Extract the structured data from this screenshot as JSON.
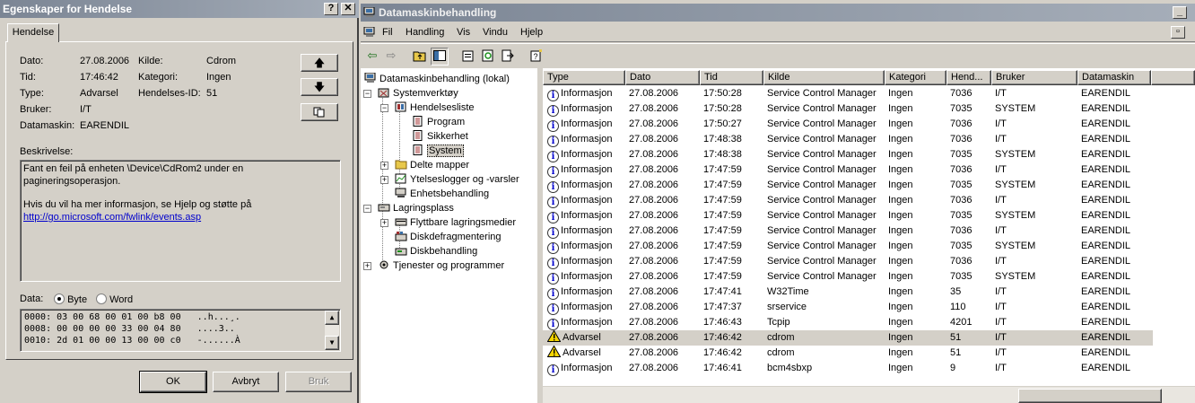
{
  "dialog": {
    "title": "Egenskaper for Hendelse",
    "tab": "Hendelse",
    "fields": {
      "dato_label": "Dato:",
      "dato": "27.08.2006",
      "tid_label": "Tid:",
      "tid": "17:46:42",
      "type_label": "Type:",
      "type": "Advarsel",
      "bruker_label": "Bruker:",
      "bruker": "I/T",
      "datamaskin_label": "Datamaskin:",
      "datamaskin": "EARENDIL",
      "kilde_label": "Kilde:",
      "kilde": "Cdrom",
      "kategori_label": "Kategori:",
      "kategori": "Ingen",
      "hendelses_id_label": "Hendelses-ID:",
      "hendelses_id": "51"
    },
    "description_label": "Beskrivelse:",
    "description_line1": "Fant en feil på enheten \\Device\\CdRom2 under en pagineringsoperasjon.",
    "description_line2": "Hvis du vil ha mer informasjon, se Hjelp og støtte på",
    "description_link": "http://go.microsoft.com/fwlink/events.asp",
    "data_label": "Data:",
    "radio_byte": "Byte",
    "radio_word": "Word",
    "hex_lines": [
      "0000: 03 00 68 00 01 00 b8 00   ..h...¸.",
      "0008: 00 00 00 00 33 00 04 80   ....3..",
      "0010: 2d 01 00 00 13 00 00 c0   -......À"
    ],
    "buttons": {
      "ok": "OK",
      "cancel": "Avbryt",
      "apply": "Bruk"
    }
  },
  "window": {
    "title": "Datamaskinbehandling",
    "menu": [
      "Fil",
      "Handling",
      "Vis",
      "Vindu",
      "Hjelp"
    ],
    "tree": [
      {
        "label": "Datamaskinbehandling (lokal)"
      },
      {
        "label": "Systemverktøy"
      },
      {
        "label": "Hendelsesliste"
      },
      {
        "label": "Program"
      },
      {
        "label": "Sikkerhet"
      },
      {
        "label": "System"
      },
      {
        "label": "Delte mapper"
      },
      {
        "label": "Ytelseslogger og -varsler"
      },
      {
        "label": "Enhetsbehandling"
      },
      {
        "label": "Lagringsplass"
      },
      {
        "label": "Flyttbare lagringsmedier"
      },
      {
        "label": "Diskdefragmentering"
      },
      {
        "label": "Diskbehandling"
      },
      {
        "label": "Tjenester og programmer"
      }
    ],
    "columns": [
      "Type",
      "Dato",
      "Tid",
      "Kilde",
      "Kategori",
      "Hend...",
      "Bruker",
      "Datamaskin"
    ],
    "rows": [
      {
        "type": "Informasjon",
        "icon": "info",
        "dato": "27.08.2006",
        "tid": "17:50:28",
        "kilde": "Service Control Manager",
        "kategori": "Ingen",
        "hend": "7036",
        "bruker": "I/T",
        "maskin": "EARENDIL"
      },
      {
        "type": "Informasjon",
        "icon": "info",
        "dato": "27.08.2006",
        "tid": "17:50:28",
        "kilde": "Service Control Manager",
        "kategori": "Ingen",
        "hend": "7035",
        "bruker": "SYSTEM",
        "maskin": "EARENDIL"
      },
      {
        "type": "Informasjon",
        "icon": "info",
        "dato": "27.08.2006",
        "tid": "17:50:27",
        "kilde": "Service Control Manager",
        "kategori": "Ingen",
        "hend": "7036",
        "bruker": "I/T",
        "maskin": "EARENDIL"
      },
      {
        "type": "Informasjon",
        "icon": "info",
        "dato": "27.08.2006",
        "tid": "17:48:38",
        "kilde": "Service Control Manager",
        "kategori": "Ingen",
        "hend": "7036",
        "bruker": "I/T",
        "maskin": "EARENDIL"
      },
      {
        "type": "Informasjon",
        "icon": "info",
        "dato": "27.08.2006",
        "tid": "17:48:38",
        "kilde": "Service Control Manager",
        "kategori": "Ingen",
        "hend": "7035",
        "bruker": "SYSTEM",
        "maskin": "EARENDIL"
      },
      {
        "type": "Informasjon",
        "icon": "info",
        "dato": "27.08.2006",
        "tid": "17:47:59",
        "kilde": "Service Control Manager",
        "kategori": "Ingen",
        "hend": "7036",
        "bruker": "I/T",
        "maskin": "EARENDIL"
      },
      {
        "type": "Informasjon",
        "icon": "info",
        "dato": "27.08.2006",
        "tid": "17:47:59",
        "kilde": "Service Control Manager",
        "kategori": "Ingen",
        "hend": "7035",
        "bruker": "SYSTEM",
        "maskin": "EARENDIL"
      },
      {
        "type": "Informasjon",
        "icon": "info",
        "dato": "27.08.2006",
        "tid": "17:47:59",
        "kilde": "Service Control Manager",
        "kategori": "Ingen",
        "hend": "7036",
        "bruker": "I/T",
        "maskin": "EARENDIL"
      },
      {
        "type": "Informasjon",
        "icon": "info",
        "dato": "27.08.2006",
        "tid": "17:47:59",
        "kilde": "Service Control Manager",
        "kategori": "Ingen",
        "hend": "7035",
        "bruker": "SYSTEM",
        "maskin": "EARENDIL"
      },
      {
        "type": "Informasjon",
        "icon": "info",
        "dato": "27.08.2006",
        "tid": "17:47:59",
        "kilde": "Service Control Manager",
        "kategori": "Ingen",
        "hend": "7036",
        "bruker": "I/T",
        "maskin": "EARENDIL"
      },
      {
        "type": "Informasjon",
        "icon": "info",
        "dato": "27.08.2006",
        "tid": "17:47:59",
        "kilde": "Service Control Manager",
        "kategori": "Ingen",
        "hend": "7035",
        "bruker": "SYSTEM",
        "maskin": "EARENDIL"
      },
      {
        "type": "Informasjon",
        "icon": "info",
        "dato": "27.08.2006",
        "tid": "17:47:59",
        "kilde": "Service Control Manager",
        "kategori": "Ingen",
        "hend": "7036",
        "bruker": "I/T",
        "maskin": "EARENDIL"
      },
      {
        "type": "Informasjon",
        "icon": "info",
        "dato": "27.08.2006",
        "tid": "17:47:59",
        "kilde": "Service Control Manager",
        "kategori": "Ingen",
        "hend": "7035",
        "bruker": "SYSTEM",
        "maskin": "EARENDIL"
      },
      {
        "type": "Informasjon",
        "icon": "info",
        "dato": "27.08.2006",
        "tid": "17:47:41",
        "kilde": "W32Time",
        "kategori": "Ingen",
        "hend": "35",
        "bruker": "I/T",
        "maskin": "EARENDIL"
      },
      {
        "type": "Informasjon",
        "icon": "info",
        "dato": "27.08.2006",
        "tid": "17:47:37",
        "kilde": "srservice",
        "kategori": "Ingen",
        "hend": "110",
        "bruker": "I/T",
        "maskin": "EARENDIL"
      },
      {
        "type": "Informasjon",
        "icon": "info",
        "dato": "27.08.2006",
        "tid": "17:46:43",
        "kilde": "Tcpip",
        "kategori": "Ingen",
        "hend": "4201",
        "bruker": "I/T",
        "maskin": "EARENDIL"
      },
      {
        "type": "Advarsel",
        "icon": "warning",
        "dato": "27.08.2006",
        "tid": "17:46:42",
        "kilde": "cdrom",
        "kategori": "Ingen",
        "hend": "51",
        "bruker": "I/T",
        "maskin": "EARENDIL",
        "selected": true
      },
      {
        "type": "Advarsel",
        "icon": "warning",
        "dato": "27.08.2006",
        "tid": "17:46:42",
        "kilde": "cdrom",
        "kategori": "Ingen",
        "hend": "51",
        "bruker": "I/T",
        "maskin": "EARENDIL"
      },
      {
        "type": "Informasjon",
        "icon": "info",
        "dato": "27.08.2006",
        "tid": "17:46:41",
        "kilde": "bcm4sbxp",
        "kategori": "Ingen",
        "hend": "9",
        "bruker": "I/T",
        "maskin": "EARENDIL"
      }
    ]
  },
  "colors": {
    "title_bar_inactive": "#7b8594",
    "face": "#d4d0c8",
    "link": "#0000cc"
  }
}
